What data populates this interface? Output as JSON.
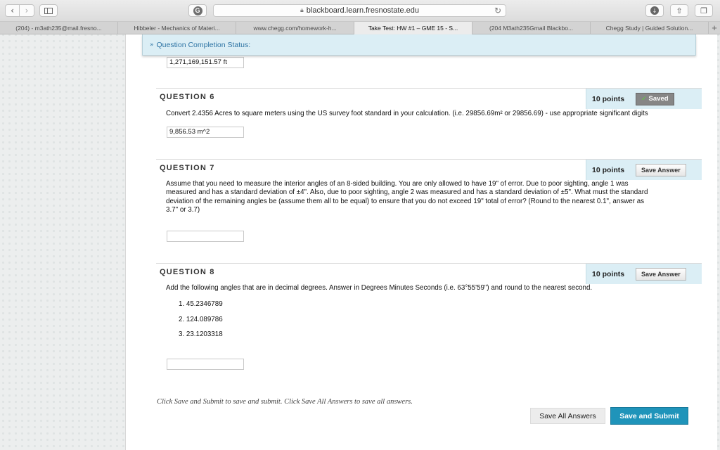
{
  "browser": {
    "url": "blackboard.learn.fresnostate.edu",
    "ext_icon_letter": "G",
    "icons": {
      "back": "chevron-left-icon",
      "forward": "chevron-right-icon",
      "lock": "lock-icon",
      "reload": "reload-icon"
    },
    "tabs": [
      {
        "label": "(204) - m3ath235@mail.fresno...",
        "active": false
      },
      {
        "label": "Hibbeler - Mechanics of Materi...",
        "active": false
      },
      {
        "label": "www.chegg.com/homework-h...",
        "active": false
      },
      {
        "label": "Take Test: HW #1 – GME 15 - S...",
        "active": true
      },
      {
        "label": "(204 M3ath235Gmail Blackbo...",
        "active": false
      },
      {
        "label": "Chegg Study | Guided Solution...",
        "active": false
      }
    ]
  },
  "status_bar": {
    "label": "Question Completion Status:"
  },
  "prev_answer": "1,271,169,151.57 ft",
  "questions": [
    {
      "title": "QUESTION 6",
      "points": "10 points",
      "button": "Saved",
      "saved": true,
      "text": "Convert 2.4356 Acres to square meters using the US survey foot standard in your calculation. (i.e. 29856.69m² or 29856.69) - use appropriate significant digits",
      "answer": "9,856.53 m^2"
    },
    {
      "title": "QUESTION 7",
      "points": "10 points",
      "button": "Save Answer",
      "saved": false,
      "text_lines": [
        "Assume that you need to measure the interior angles of an 8-sided building. You are only allowed to have 19\" of error. Due to poor sighting, angle 1 was",
        "measured and has a standard deviation of ±4\". Also, due to poor sighting, angle 2 was measured and has a standard deviation of ±5\". What must the standard",
        "deviation of the remaining angles be (assume them all to be equal) to ensure that you do not exceed 19\" total of error? (Round to the nearest 0.1\", answer as",
        "3.7\" or 3.7)"
      ],
      "answer": ""
    },
    {
      "title": "QUESTION 8",
      "points": "10 points",
      "button": "Save Answer",
      "saved": false,
      "text": "Add the following angles that are in decimal degrees. Answer in Degrees Minutes Seconds (i.e. 63°55'59\") and round to the nearest second.",
      "choices": [
        "1.  45.2346789",
        "2.  124.089786",
        "3.  23.1203318"
      ],
      "answer": ""
    }
  ],
  "footer": {
    "note": "Click Save and Submit to save and submit. Click Save All Answers to save all answers.",
    "save_all": "Save All Answers",
    "save_submit": "Save and Submit"
  },
  "colors": {
    "accent": "#1f94ba",
    "panel_blue": "#dbeef5",
    "status_text": "#2e74a4"
  }
}
